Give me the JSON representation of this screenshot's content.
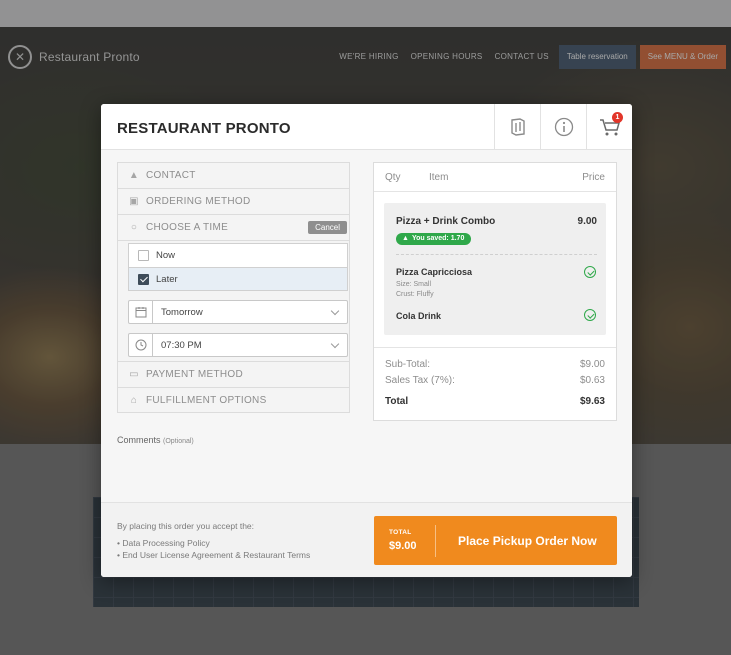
{
  "site": {
    "name": "Restaurant Pronto",
    "nav": [
      "WE'RE HIRING",
      "OPENING HOURS",
      "CONTACT US"
    ],
    "reservation_button": "Table reservation",
    "menu_button": "See MENU & Order"
  },
  "modal": {
    "title": "RESTAURANT PRONTO",
    "cart_count": "1",
    "sections": {
      "contact": "CONTACT",
      "ordering_method": "ORDERING METHOD",
      "choose_time": "CHOOSE A TIME",
      "cancel": "Cancel",
      "payment_method": "PAYMENT METHOD",
      "fulfillment": "FULFILLMENT OPTIONS"
    },
    "time_options": [
      {
        "label": "Now",
        "checked": false
      },
      {
        "label": "Later",
        "checked": true
      }
    ],
    "day_select": "Tomorrow",
    "time_select": "07:30 PM",
    "comments_label": "Comments",
    "comments_optional": "(Optional)",
    "cart": {
      "headers": {
        "qty": "Qty",
        "item": "Item",
        "price": "Price"
      },
      "combo_name": "Pizza + Drink Combo",
      "combo_price": "9.00",
      "saved": "You saved: 1.70",
      "pizza_name": "Pizza Capricciosa",
      "pizza_size": "Size: Small",
      "pizza_crust": "Crust: Fluffy",
      "drink_name": "Cola Drink",
      "subtotal_label": "Sub-Total:",
      "subtotal": "$9.00",
      "tax_label": "Sales Tax (7%):",
      "tax": "$0.63",
      "total_label": "Total",
      "total": "$9.63"
    },
    "footer": {
      "terms_intro": "By placing this order you accept the:",
      "terms": [
        "Data Processing Policy",
        "End User License Agreement & Restaurant Terms"
      ],
      "total_label": "TOTAL",
      "total_value": "$9.00",
      "order_button": "Place Pickup Order Now"
    }
  },
  "colors": {
    "accent_orange": "#f08a1e",
    "saved_green": "#2fa84a",
    "badge_red": "#e2362a",
    "nav_blue": "#334a63"
  }
}
